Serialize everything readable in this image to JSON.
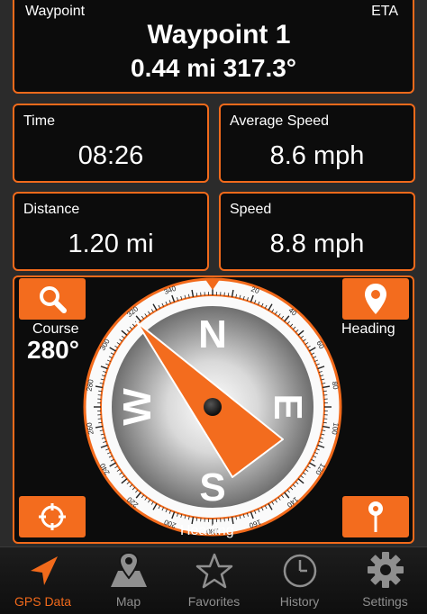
{
  "waypoint": {
    "label": "Waypoint",
    "eta_label": "ETA",
    "name": "Waypoint 1",
    "distance_bearing": "0.44 mi 317.3°"
  },
  "time": {
    "label": "Time",
    "value": "08:26"
  },
  "average_speed": {
    "label": "Average Speed",
    "value": "8.6 mph"
  },
  "distance": {
    "label": "Distance",
    "value": "1.20 mi"
  },
  "speed": {
    "label": "Speed",
    "value": "8.8 mph"
  },
  "compass": {
    "course_label": "Course",
    "course_value": "280°",
    "heading_label": "Heading",
    "bottom_heading_label": "Heading",
    "cardinal": {
      "n": "N",
      "e": "E",
      "s": "S",
      "w": "W"
    },
    "needle_bearing_deg": 317.3,
    "ticks": [
      "0",
      "10",
      "20",
      "30",
      "40",
      "50",
      "60",
      "70",
      "80",
      "90",
      "100",
      "110",
      "120",
      "130",
      "140",
      "150",
      "160",
      "170",
      "180",
      "190",
      "200",
      "210",
      "220",
      "230",
      "240",
      "250",
      "260",
      "270",
      "280",
      "290",
      "300",
      "310",
      "320",
      "330",
      "340",
      "350"
    ]
  },
  "tabs": [
    {
      "label": "GPS Data",
      "icon": "location-arrow-icon",
      "active": true
    },
    {
      "label": "Map",
      "icon": "map-icon",
      "active": false
    },
    {
      "label": "Favorites",
      "icon": "star-icon",
      "active": false
    },
    {
      "label": "History",
      "icon": "clock-icon",
      "active": false
    },
    {
      "label": "Settings",
      "icon": "gear-icon",
      "active": false
    }
  ],
  "colors": {
    "accent": "#f26a1b",
    "panel": "#0c0c0c",
    "background": "#2b2b2b",
    "tab_inactive": "#8f8f8f"
  }
}
